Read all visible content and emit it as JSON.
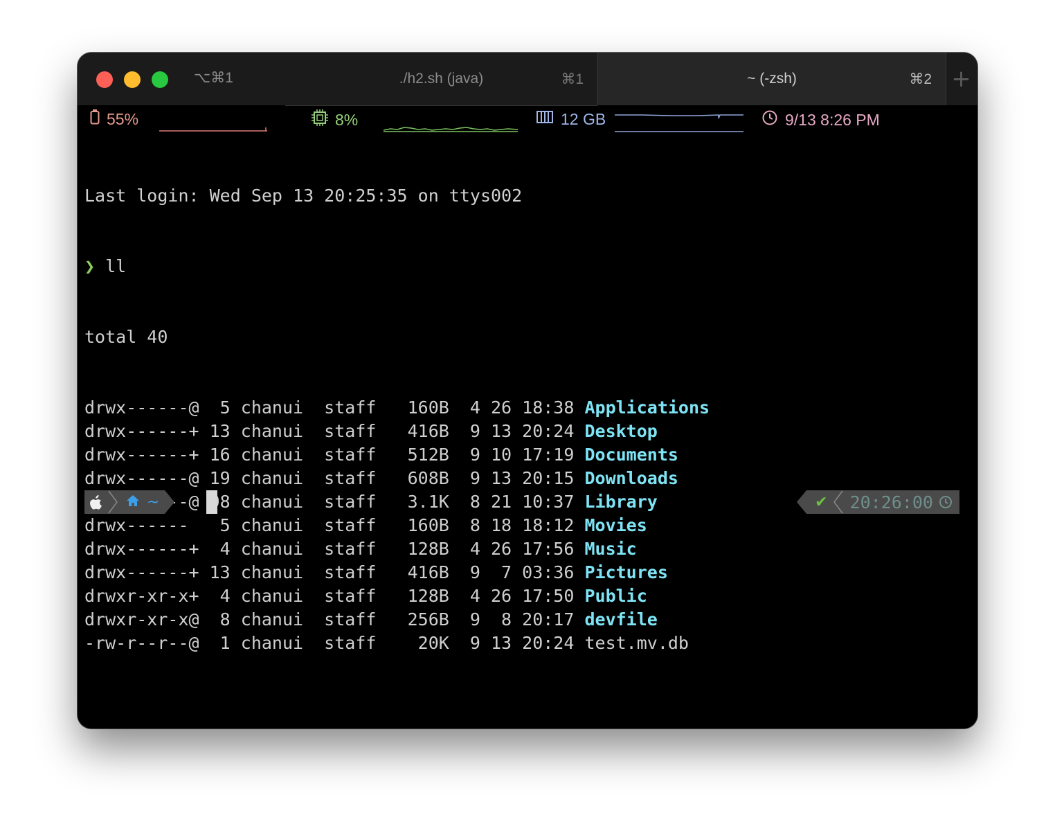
{
  "window": {
    "shortcut": "⌥⌘1",
    "tabs": [
      {
        "title": "./h2.sh (java)",
        "shortcut": "⌘1",
        "active": false
      },
      {
        "title": "~ (-zsh)",
        "shortcut": "⌘2",
        "active": true
      }
    ],
    "new_tab_icon": "+"
  },
  "status": {
    "battery": {
      "icon": "battery-icon",
      "value": "55%",
      "color": "#e79a8f"
    },
    "cpu": {
      "icon": "cpu-icon",
      "value": "8%",
      "color": "#95d17a"
    },
    "memory": {
      "icon": "memory-icon",
      "value": "12 GB",
      "color": "#9fb6e8"
    },
    "clock": {
      "icon": "clock-icon",
      "value": "9/13 8:26 PM",
      "color": "#e7a9c4"
    }
  },
  "terminal": {
    "last_login": "Last login: Wed Sep 13 20:25:35 on ttys002",
    "prompt_symbol": "❯",
    "command": " ll",
    "total": "total 40",
    "listing": [
      {
        "meta": "drwx------@  5 chanui  staff   160B  4 26 18:38 ",
        "name": "Applications",
        "is_dir": true
      },
      {
        "meta": "drwx------+ 13 chanui  staff   416B  9 13 20:24 ",
        "name": "Desktop",
        "is_dir": true
      },
      {
        "meta": "drwx------+ 16 chanui  staff   512B  9 10 17:19 ",
        "name": "Documents",
        "is_dir": true
      },
      {
        "meta": "drwx------@ 19 chanui  staff   608B  9 13 20:15 ",
        "name": "Downloads",
        "is_dir": true
      },
      {
        "meta": "drwx------@ 98 chanui  staff   3.1K  8 21 10:37 ",
        "name": "Library",
        "is_dir": true
      },
      {
        "meta": "drwx------   5 chanui  staff   160B  8 18 18:12 ",
        "name": "Movies",
        "is_dir": true
      },
      {
        "meta": "drwx------+  4 chanui  staff   128B  4 26 17:56 ",
        "name": "Music",
        "is_dir": true
      },
      {
        "meta": "drwx------+ 13 chanui  staff   416B  9  7 03:36 ",
        "name": "Pictures",
        "is_dir": true
      },
      {
        "meta": "drwxr-xr-x+  4 chanui  staff   128B  4 26 17:50 ",
        "name": "Public",
        "is_dir": true
      },
      {
        "meta": "drwxr-xr-x@  8 chanui  staff   256B  9  8 20:17 ",
        "name": "devfile",
        "is_dir": true
      },
      {
        "meta": "-rw-r--r--@  1 chanui  staff    20K  9 13 20:24 ",
        "name": "test.mv.db",
        "is_dir": false
      }
    ]
  },
  "powerline": {
    "os_icon": "apple-icon",
    "home_icon": "home-icon",
    "path": "~",
    "status_check": "✔",
    "time": "20:26:00",
    "time_icon": "clock-icon"
  }
}
